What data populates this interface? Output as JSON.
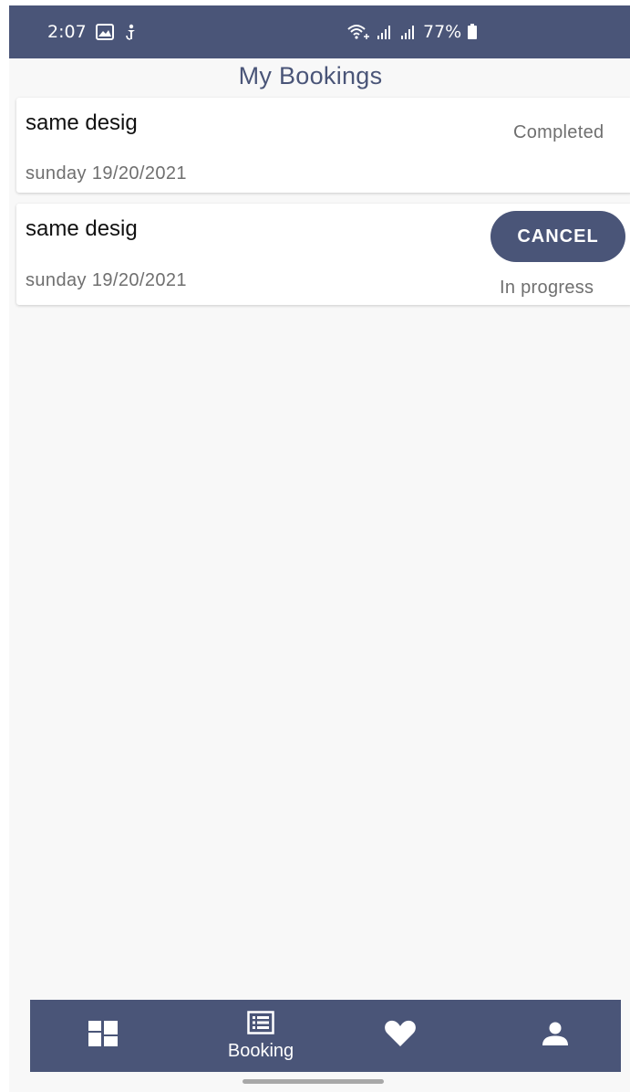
{
  "status_bar": {
    "time": "2:07",
    "battery": "77%",
    "icons": [
      "gallery-icon",
      "accessibility-icon",
      "wifi-icon",
      "signal-icon",
      "signal-icon",
      "battery-icon"
    ]
  },
  "header": {
    "title": "My Bookings"
  },
  "bookings": [
    {
      "title": "same desig",
      "date": "sunday 19/20/2021",
      "status": "Completed"
    },
    {
      "title": "same desig",
      "date": "sunday 19/20/2021",
      "status": "In progress",
      "action_label": "CANCEL"
    }
  ],
  "bottom_nav": {
    "items": [
      {
        "icon": "dashboard-icon",
        "label": ""
      },
      {
        "icon": "booking-list-icon",
        "label": "Booking"
      },
      {
        "icon": "heart-icon",
        "label": ""
      },
      {
        "icon": "profile-icon",
        "label": ""
      }
    ]
  },
  "colors": {
    "primary": "#4a5578",
    "background": "#f8f8f8",
    "card": "#ffffff",
    "muted_text": "#6f6f6f"
  }
}
